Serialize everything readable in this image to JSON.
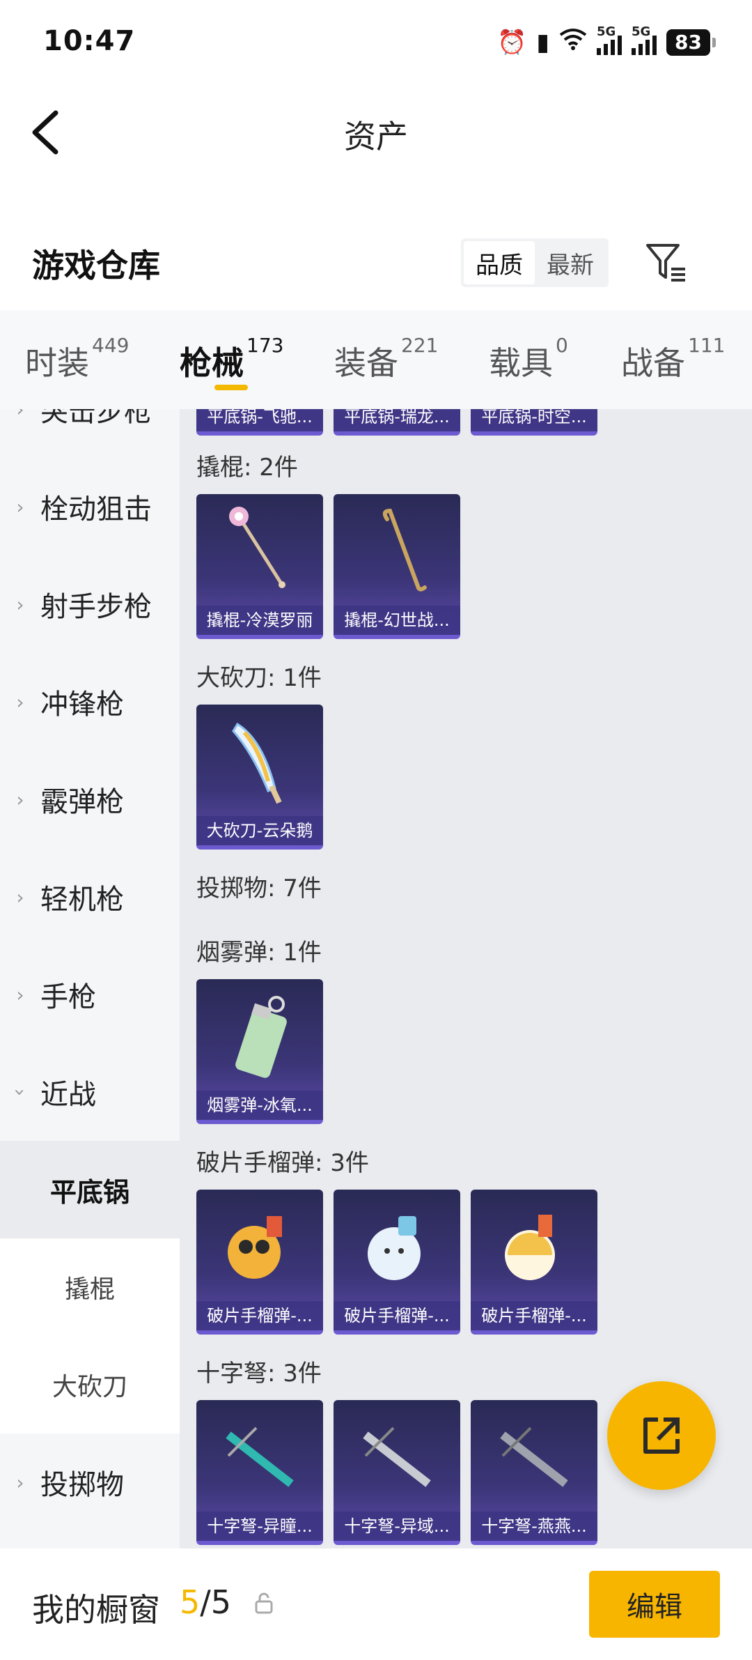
{
  "status": {
    "time": "10:47",
    "battery": "83",
    "signal1": "5G",
    "signal2": "5G"
  },
  "header": {
    "title": "资产"
  },
  "warehouse": {
    "title": "游戏仓库",
    "sort_quality": "品质",
    "sort_latest": "最新"
  },
  "tabs": [
    {
      "label": "时装",
      "count": "449"
    },
    {
      "label": "枪械",
      "count": "173"
    },
    {
      "label": "装备",
      "count": "221"
    },
    {
      "label": "载具",
      "count": "0"
    },
    {
      "label": "战备",
      "count": "111"
    }
  ],
  "sidebar": {
    "items": [
      "突击步枪",
      "栓动狙击",
      "射手步枪",
      "冲锋枪",
      "霰弹枪",
      "轻机枪",
      "手枪",
      "近战"
    ],
    "subs": [
      "平底锅",
      "撬棍",
      "大砍刀"
    ],
    "last": "投掷物"
  },
  "content": {
    "top_cards": [
      "平底锅-飞驰...",
      "平底锅-瑞龙...",
      "平底锅-时空..."
    ],
    "sections": [
      {
        "title": "撬棍: 2件",
        "items": [
          "撬棍-冷漠罗丽",
          "撬棍-幻世战..."
        ]
      },
      {
        "title": "大砍刀: 1件",
        "items": [
          "大砍刀-云朵鹅"
        ]
      },
      {
        "title": "投掷物: 7件"
      },
      {
        "title": "烟雾弹: 1件",
        "items": [
          "烟雾弹-冰氧..."
        ]
      },
      {
        "title": "破片手榴弹: 3件",
        "items": [
          "破片手榴弹-...",
          "破片手榴弹-...",
          "破片手榴弹-..."
        ]
      },
      {
        "title": "十字弩: 3件",
        "items": [
          "十字弩-异瞳...",
          "十字弩-异域...",
          "十字弩-燕燕..."
        ]
      }
    ]
  },
  "bottom": {
    "label": "我的橱窗",
    "current": "5",
    "total": "/5",
    "edit": "编辑"
  },
  "colors": {
    "accent": "#f7b500",
    "card": "#3b3577"
  }
}
